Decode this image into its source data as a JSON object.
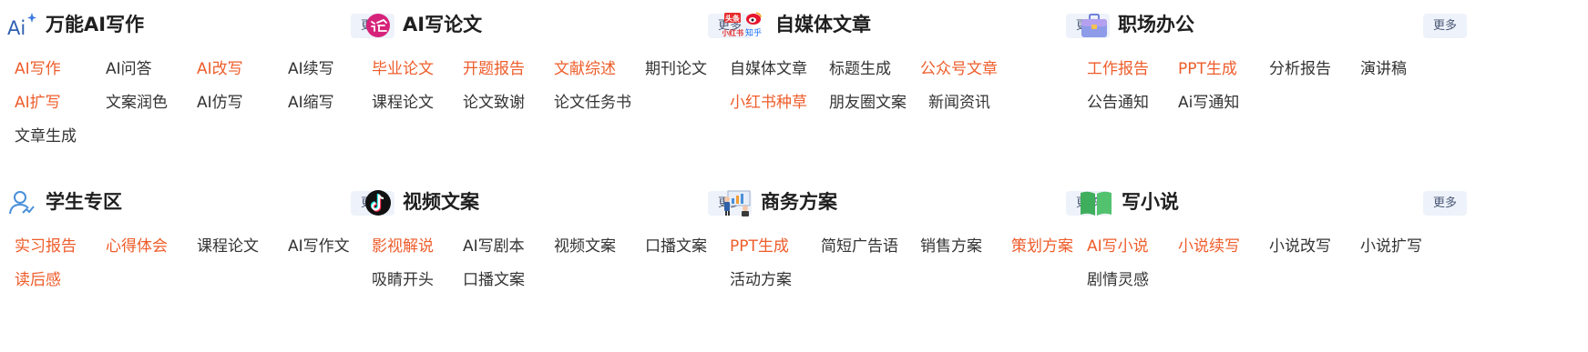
{
  "more_label": "更多",
  "colors": {
    "accent": "#ee5d2b",
    "text": "#333333",
    "more_bg": "#eef2fa",
    "more_text": "#4a5876"
  },
  "sections": [
    {
      "title": "万能AI写作",
      "icon": "ai-sparkle-icon",
      "items": [
        {
          "label": "AI写作",
          "hot": true
        },
        {
          "label": "AI问答",
          "hot": false
        },
        {
          "label": "AI改写",
          "hot": true
        },
        {
          "label": "AI续写",
          "hot": false
        },
        {
          "label": "AI扩写",
          "hot": true
        },
        {
          "label": "文案润色",
          "hot": false
        },
        {
          "label": "AI仿写",
          "hot": false
        },
        {
          "label": "AI缩写",
          "hot": false
        },
        {
          "label": "文章生成",
          "hot": false
        }
      ]
    },
    {
      "title": "AI写论文",
      "icon": "paper-lun-icon",
      "items": [
        {
          "label": "毕业论文",
          "hot": true
        },
        {
          "label": "开题报告",
          "hot": true
        },
        {
          "label": "文献综述",
          "hot": true
        },
        {
          "label": "期刊论文",
          "hot": false
        },
        {
          "label": "课程论文",
          "hot": false
        },
        {
          "label": "论文致谢",
          "hot": false
        },
        {
          "label": "论文任务书",
          "hot": false
        }
      ]
    },
    {
      "title": "自媒体文章",
      "icon": "media-platforms-icon",
      "icon_text": {
        "toutiao": "头条",
        "xiaohongshu": "小红书",
        "zhihu": "知乎"
      },
      "items": [
        {
          "label": "自媒体文章",
          "hot": false
        },
        {
          "label": "标题生成",
          "hot": false
        },
        {
          "label": "公众号文章",
          "hot": true
        },
        {
          "label": "小红书种草",
          "hot": true
        },
        {
          "label": "朋友圈文案",
          "hot": false
        },
        {
          "label": "新闻资讯",
          "hot": false
        }
      ]
    },
    {
      "title": "职场办公",
      "icon": "briefcase-icon",
      "items": [
        {
          "label": "工作报告",
          "hot": true
        },
        {
          "label": "PPT生成",
          "hot": true
        },
        {
          "label": "分析报告",
          "hot": false
        },
        {
          "label": "演讲稿",
          "hot": false
        },
        {
          "label": "公告通知",
          "hot": false
        },
        {
          "label": "Ai写通知",
          "hot": false
        }
      ]
    },
    {
      "title": "学生专区",
      "icon": "student-icon",
      "items": [
        {
          "label": "实习报告",
          "hot": true
        },
        {
          "label": "心得体会",
          "hot": true
        },
        {
          "label": "课程论文",
          "hot": false
        },
        {
          "label": "AI写作文",
          "hot": false
        },
        {
          "label": "读后感",
          "hot": true
        }
      ]
    },
    {
      "title": "视频文案",
      "icon": "tiktok-icon",
      "items": [
        {
          "label": "影视解说",
          "hot": true
        },
        {
          "label": "AI写剧本",
          "hot": false
        },
        {
          "label": "视频文案",
          "hot": false
        },
        {
          "label": "口播文案",
          "hot": false
        },
        {
          "label": "吸睛开头",
          "hot": false
        },
        {
          "label": "口播文案",
          "hot": false
        }
      ]
    },
    {
      "title": "商务方案",
      "icon": "business-presentation-icon",
      "items": [
        {
          "label": "PPT生成",
          "hot": true
        },
        {
          "label": "简短广告语",
          "hot": false
        },
        {
          "label": "销售方案",
          "hot": false
        },
        {
          "label": "策划方案",
          "hot": true
        },
        {
          "label": "活动方案",
          "hot": false
        }
      ]
    },
    {
      "title": "写小说",
      "icon": "open-book-icon",
      "items": [
        {
          "label": "AI写小说",
          "hot": true
        },
        {
          "label": "小说续写",
          "hot": true
        },
        {
          "label": "小说改写",
          "hot": false
        },
        {
          "label": "小说扩写",
          "hot": false
        },
        {
          "label": "剧情灵感",
          "hot": false
        }
      ]
    }
  ]
}
